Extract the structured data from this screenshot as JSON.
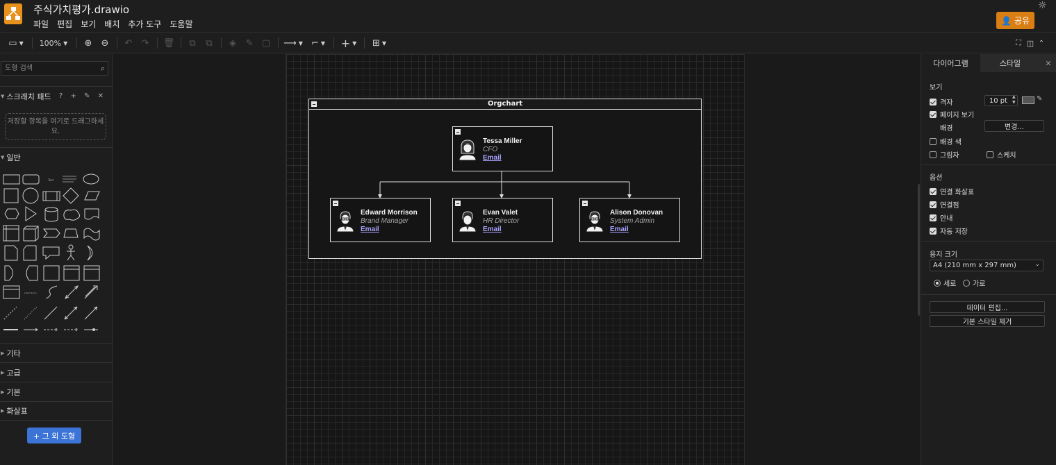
{
  "app": {
    "doc_title": "주식가치평가.drawio",
    "menu": [
      "파일",
      "편집",
      "보기",
      "배치",
      "추가 도구",
      "도움말"
    ],
    "share_label": "공유"
  },
  "toolbar": {
    "zoom": "100%"
  },
  "left": {
    "search_placeholder": "도형 검색",
    "scratchpad_title": "스크래치 패드",
    "scratchpad_tools": "? + ✎ ✕",
    "dropzone_text": "저장할 항목을 여기로 드래그하세요.",
    "general_title": "일반",
    "sections": [
      "기타",
      "고급",
      "기본",
      "화살표"
    ],
    "more_shapes": "+ 그 외 도형"
  },
  "diagram": {
    "container_title": "Orgchart",
    "cards": [
      {
        "name": "Tessa Miller",
        "role": "CFO",
        "link": "Email"
      },
      {
        "name": "Edward Morrison",
        "role": "Brand Manager",
        "link": "Email"
      },
      {
        "name": "Evan Valet",
        "role": "HR Director",
        "link": "Email"
      },
      {
        "name": "Alison Donovan",
        "role": "System Admin",
        "link": "Email"
      }
    ]
  },
  "right": {
    "tab_diagram": "다이어그램",
    "tab_style": "스타일",
    "view_title": "보기",
    "grid_label": "격자",
    "grid_size": "10 pt",
    "page_view_label": "페이지 보기",
    "background_label": "배경",
    "change_label": "변경...",
    "bg_color_label": "배경 색",
    "shadow_label": "그림자",
    "sketch_label": "스케치",
    "options_title": "옵션",
    "options": [
      "연결 화살표",
      "연결점",
      "안내",
      "자동 저장"
    ],
    "paper_title": "용지 크기",
    "paper_value": "A4 (210 mm x 297 mm)",
    "portrait": "세로",
    "landscape": "가로",
    "edit_data": "데이터 편집...",
    "clear_style": "기본 스타일 제거"
  },
  "colors": {
    "accent_orange": "#d97e12",
    "link_color": "#a8a4ff",
    "primary_blue": "#3b74d6"
  }
}
